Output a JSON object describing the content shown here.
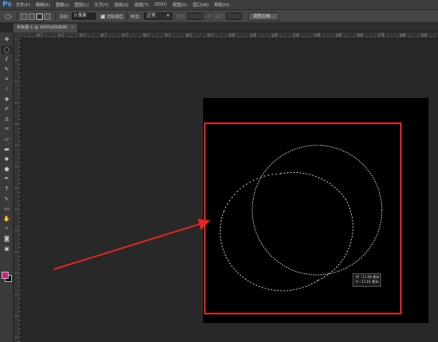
{
  "app": {
    "logo": "Ps"
  },
  "menu": [
    "文件(F)",
    "编辑(E)",
    "图像(I)",
    "图层(L)",
    "文字(Y)",
    "选择(S)",
    "滤镜(T)",
    "3D(D)",
    "视图(V)",
    "窗口(W)",
    "帮助(H)"
  ],
  "options": {
    "feather_label": "羽化:",
    "feather_value": "0 像素",
    "antialias_label": "消除锯齿",
    "style_label": "样式:",
    "style_value": "正常",
    "width_label": "宽度:",
    "height_label": "高度:",
    "swap_glyph": "⇄",
    "refine_button": "调整边缘..."
  },
  "document": {
    "tab_title": "未标题-1 @ 100%(RGB/8)",
    "close_glyph": "×"
  },
  "ruler_ticks": [
    "10",
    "20",
    "30",
    "40",
    "50",
    "60",
    "70",
    "80",
    "90",
    "100",
    "110",
    "120",
    "130",
    "140",
    "150",
    "160",
    "170",
    "180",
    "190",
    "200"
  ],
  "selection_readout": {
    "w": "W : 11.68 厘米",
    "h": "H : 11.01 厘米"
  },
  "colors": {
    "foreground": "#c7257a",
    "background": "#000000",
    "annotation": "#e8231e"
  },
  "tools": [
    {
      "name": "move-tool-icon",
      "glyph": "✥"
    },
    {
      "name": "elliptical-marquee-tool-icon",
      "glyph": "◯"
    },
    {
      "name": "lasso-tool-icon",
      "glyph": "ℓ"
    },
    {
      "name": "quick-selection-tool-icon",
      "glyph": "✎"
    },
    {
      "name": "crop-tool-icon",
      "glyph": "⌗"
    },
    {
      "name": "eyedropper-tool-icon",
      "glyph": "⁄"
    },
    {
      "name": "healing-brush-tool-icon",
      "glyph": "✚"
    },
    {
      "name": "brush-tool-icon",
      "glyph": "✐"
    },
    {
      "name": "clone-stamp-tool-icon",
      "glyph": "♙"
    },
    {
      "name": "history-brush-tool-icon",
      "glyph": "✑"
    },
    {
      "name": "eraser-tool-icon",
      "glyph": "▱"
    },
    {
      "name": "gradient-tool-icon",
      "glyph": "▬"
    },
    {
      "name": "blur-tool-icon",
      "glyph": "◆"
    },
    {
      "name": "dodge-tool-icon",
      "glyph": "●"
    },
    {
      "name": "pen-tool-icon",
      "glyph": "✒"
    },
    {
      "name": "type-tool-icon",
      "glyph": "T"
    },
    {
      "name": "path-selection-tool-icon",
      "glyph": "↖"
    },
    {
      "name": "rectangle-tool-icon",
      "glyph": "▭"
    },
    {
      "name": "hand-tool-icon",
      "glyph": "✋"
    },
    {
      "name": "zoom-tool-icon",
      "glyph": "⌕"
    },
    {
      "name": "quick-mask-icon",
      "glyph": "◙"
    },
    {
      "name": "screen-mode-icon",
      "glyph": "▣"
    }
  ]
}
